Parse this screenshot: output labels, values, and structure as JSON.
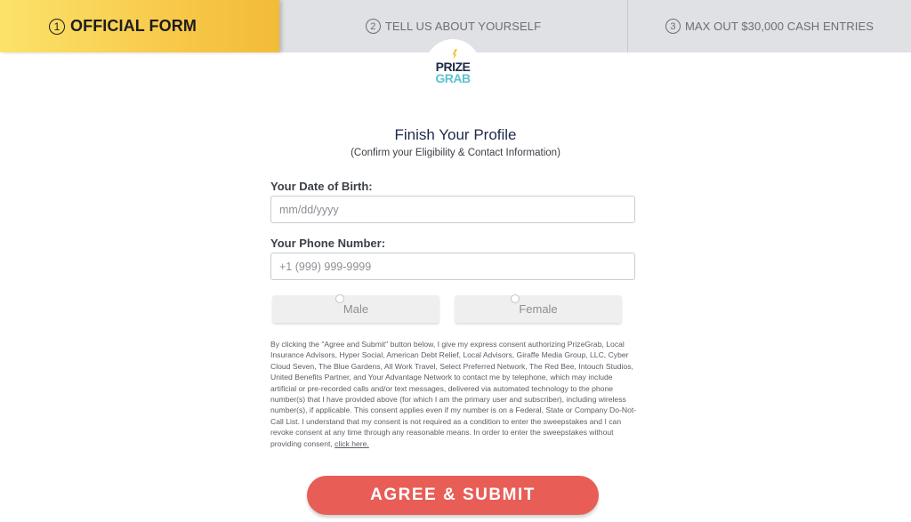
{
  "steps": [
    {
      "num": "1",
      "label": "OFFICIAL FORM"
    },
    {
      "num": "2",
      "label": "TELL US ABOUT YOURSELF"
    },
    {
      "num": "3",
      "label": "MAX OUT $30,000 CASH ENTRIES"
    }
  ],
  "logo": {
    "line1": "PRIZE",
    "line2": "GRAB"
  },
  "header": {
    "title": "Finish Your Profile",
    "subtitle": "(Confirm your Eligibility & Contact Information)"
  },
  "form": {
    "dob": {
      "label": "Your Date of Birth:",
      "placeholder": "mm/dd/yyyy",
      "value": ""
    },
    "phone": {
      "label": "Your Phone Number:",
      "placeholder": "+1 (999) 999-9999",
      "value": ""
    },
    "gender": {
      "male": "Male",
      "female": "Female"
    }
  },
  "consent": {
    "text": "By clicking the \"Agree and Submit\" button below, I give my express consent authorizing PrizeGrab, Local Insurance Advisors, Hyper Social, American Debt Relief, Local Advisors, Giraffe Media Group, LLC, Cyber Cloud Seven, The Blue Gardens, All Work Travel, Select Preferred Network, The Red Bee, Intouch Studios, United Benefits Partner, and Your Advantage Network to contact me by telephone, which may include artificial or pre-recorded calls and/or text messages, delivered via automated technology to the phone number(s) that I have provided above (for which I am the primary user and subscriber), including wireless number(s), if applicable. This consent applies even if my number is on a Federal, State or Company Do-Not-Call List. I understand that my consent is not required as a condition to enter the sweepstakes and I can revoke consent at any time through any reasonable means. In order to enter the sweepstakes without providing consent,",
    "link": "click here."
  },
  "submit_label": "AGREE & SUBMIT",
  "colors": {
    "active_step": "#f8c94b",
    "submit": "#e85d56",
    "title": "#1e2a4a"
  }
}
